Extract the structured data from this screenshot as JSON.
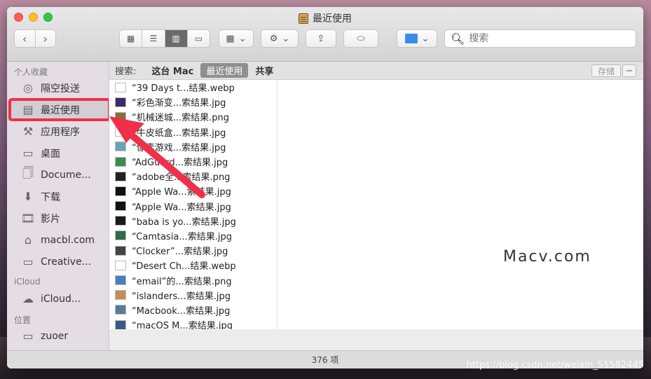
{
  "window": {
    "title": "最近使用"
  },
  "toolbar": {
    "back_icon": "chevron-left",
    "forward_icon": "chevron-right",
    "search_placeholder": "搜索"
  },
  "sidebar": {
    "sections": [
      {
        "title": "个人收藏"
      },
      {
        "title": "iCloud"
      },
      {
        "title": "位置"
      }
    ],
    "favorites": [
      {
        "label": "隔空投送",
        "icon": "airdrop-icon"
      },
      {
        "label": "最近使用",
        "icon": "recents-icon"
      },
      {
        "label": "应用程序",
        "icon": "applications-icon"
      },
      {
        "label": "桌面",
        "icon": "desktop-icon"
      },
      {
        "label": "Docume...",
        "icon": "documents-icon"
      },
      {
        "label": "下载",
        "icon": "downloads-icon"
      },
      {
        "label": "影片",
        "icon": "movies-icon"
      },
      {
        "label": "macbl.com",
        "icon": "home-icon"
      },
      {
        "label": "Creative...",
        "icon": "folder-icon"
      }
    ],
    "icloud": [
      {
        "label": "iCloud...",
        "icon": "cloud-icon"
      }
    ],
    "locations": [
      {
        "label": "zuoer",
        "icon": "disk-icon"
      }
    ]
  },
  "pathbar": {
    "search_label": "搜索:",
    "scope_this_mac": "这台 Mac",
    "scope_recents": "最近使用",
    "scope_shared": "共享",
    "save_label": "存储",
    "minus_label": "−"
  },
  "files": [
    {
      "name": "“39 Days t...结果.webp",
      "thumb_color": "#ffffff"
    },
    {
      "name": "“彩色渐变...索结果.jpg",
      "thumb_color": "#3b2a6b"
    },
    {
      "name": "“机械迷城...索结果.png",
      "thumb_color": "#8a6b3a"
    },
    {
      "name": "“牛皮纸盒...索结果.jpg",
      "thumb_color": "#ffffff"
    },
    {
      "name": "“像素游戏...索结果.jpg",
      "thumb_color": "#6aa3b5"
    },
    {
      "name": "“AdGuard...索结果.jpg",
      "thumb_color": "#3c8c4f"
    },
    {
      "name": "“adobe全...索结果.png",
      "thumb_color": "#222222"
    },
    {
      "name": "“Apple Wa...索结果.jpg",
      "thumb_color": "#111111"
    },
    {
      "name": "“Apple Wa...索结果.jpg",
      "thumb_color": "#111111"
    },
    {
      "name": "“baba is yo...索结果.jpg",
      "thumb_color": "#1a1a1a"
    },
    {
      "name": "“Camtasia...索结果.jpg",
      "thumb_color": "#2d6b4a"
    },
    {
      "name": "“Clocker”...索结果.jpg",
      "thumb_color": "#444444"
    },
    {
      "name": "“Desert Ch...结果.webp",
      "thumb_color": "#ffffff"
    },
    {
      "name": "“email”的...索结果.png",
      "thumb_color": "#4a7fbf"
    },
    {
      "name": "“islanders...索结果.jpg",
      "thumb_color": "#c98a5a"
    },
    {
      "name": "“Macbook...索结果.jpg",
      "thumb_color": "#5a7a9a"
    },
    {
      "name": "“macOS M...索结果.jpg",
      "thumb_color": "#3a5a8a"
    }
  ],
  "status": {
    "count": "376 项"
  },
  "watermarks": {
    "brand": "Macv.com",
    "url": "https://blog.csdn.net/weixin_51582445"
  },
  "colors": {
    "highlight": "#f0304a",
    "arrow": "#f0304a",
    "selected_scope": "#8f8f8f"
  }
}
